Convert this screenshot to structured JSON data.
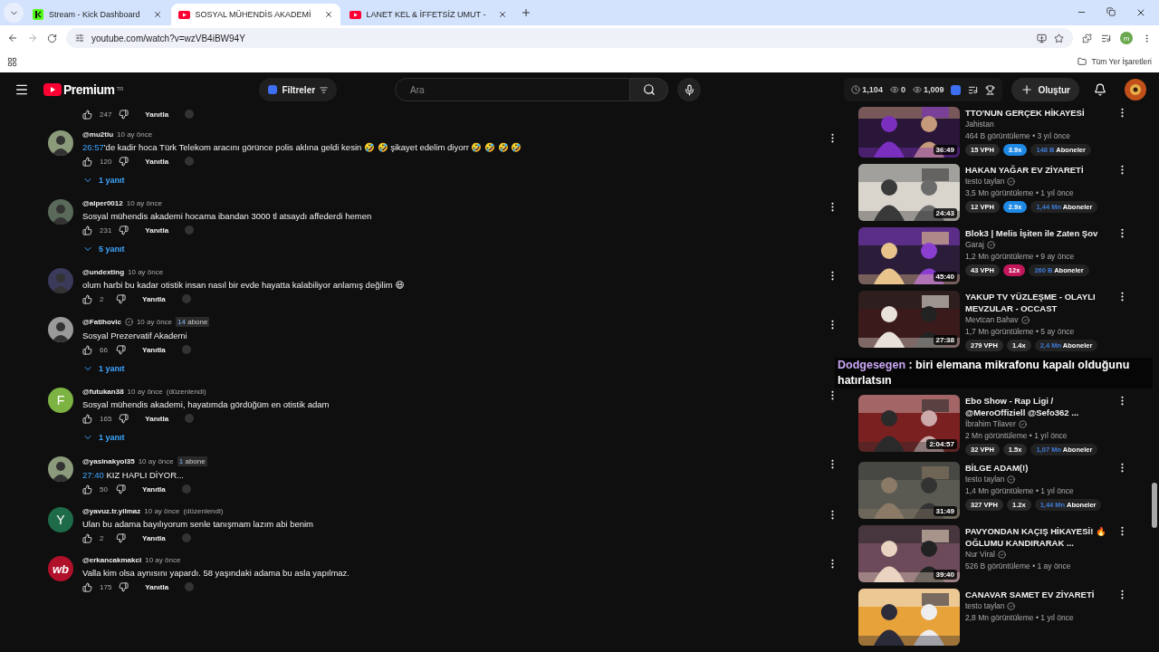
{
  "browser": {
    "tabs": [
      {
        "kind": "kick",
        "title": "Stream - Kick Dashboard",
        "selected": false
      },
      {
        "kind": "video",
        "title": "SOSYAL MÜHENDİS AKADEMİ",
        "selected": true
      },
      {
        "kind": "video",
        "title": "LANET KEL & İFFETSİZ UMUT -",
        "selected": false
      }
    ],
    "url": "youtube.com/watch?v=wzVB4iBW94Y",
    "profile": "m",
    "bookmarks_label": "Tüm Yer İşaretleri"
  },
  "header": {
    "logo": "Premium",
    "region": "TR",
    "filter_button": "Filtreler",
    "search": {
      "placeholder": "Ara"
    },
    "stats": [
      {
        "kind": "clock",
        "value": "1,104"
      },
      {
        "kind": "eye",
        "value": "0"
      },
      {
        "kind": "eye",
        "value": "1,009"
      }
    ],
    "create_button": "Oluştur"
  },
  "top_actions": {
    "likes": "247",
    "reply": "Yanıtla"
  },
  "comments": [
    {
      "user": "@mu2tlu",
      "time": "10 ay önce",
      "link": "26:57",
      "text": "'de kadir hoca Türk Telekom aracını görünce polis aklına geldi kesin 🤣 🤣 şikayet edelim diyorr 🤣 🤣 🤣 🤣",
      "likes": "120",
      "reply": "Yanıtla",
      "replies": "1 yanıt"
    },
    {
      "user": "@alper0012",
      "time": "10 ay önce",
      "text": "Sosyal mühendis akademi hocama ibandan 3000 tl atsaydı affederdi hemen",
      "likes": "231",
      "reply": "Yanıtla",
      "replies": "5 yanıt"
    },
    {
      "user": "@undexting",
      "time": "10 ay önce",
      "text": "olum harbi bu kadar otistik insan nasıl bir evde hayatta kalabiliyor anlamış değilim 😆",
      "likes": "2",
      "reply": "Yanıtla"
    },
    {
      "user": "@Fatihovic",
      "verified": true,
      "time": "10 ay önce",
      "badge": {
        "count": "14",
        "label": "abone"
      },
      "text": "Sosyal Prezervatif Akademi",
      "likes": "66",
      "reply": "Yanıtla",
      "replies": "1 yanıt"
    },
    {
      "user": "@futukan38",
      "time": "10 ay önce",
      "edited": "(düzenlendi)",
      "avatar": {
        "kind": "letter",
        "letter": "F",
        "color": "#7cb342"
      },
      "text": "Sosyal mühendis akademi, hayatımda gördüğüm en otistik adam",
      "likes": "165",
      "reply": "Yanıtla",
      "replies": "1 yanıt"
    },
    {
      "user": "@yasinakyol35",
      "time": "10 ay önce",
      "badge": {
        "count": "1",
        "label": "abone"
      },
      "link": "27:40",
      "text": " KIZ HAPLI DİYOR...",
      "likes": "50",
      "reply": "Yanıtla"
    },
    {
      "user": "@yavuz.tr.yilmaz",
      "time": "10 ay önce",
      "edited": "(düzenlendi)",
      "avatar": {
        "kind": "letter",
        "letter": "Y",
        "color": "#1e6b4a"
      },
      "text": "Ulan bu adama bayılıyorum senle tanışmam lazım abi benim",
      "likes": "2",
      "reply": "Yanıtla"
    },
    {
      "user": "@erkancakmakci",
      "time": "10 ay önce",
      "avatar": {
        "kind": "letter",
        "letter": "wb",
        "color": "#b0102a"
      },
      "text": "Valla kim olsa aynısını yapardı. 58 yaşındaki adama bu asla yapılmaz.",
      "likes": "175",
      "reply": "Yanıtla"
    }
  ],
  "videos": [
    {
      "title": "TTO'NUN GERÇEK HİKAYESİ",
      "channel": "Jahistan",
      "verified": false,
      "meta": "464 B görüntüleme • 3 yıl önce",
      "duration": "36:49",
      "stats": {
        "vph": "15 VPH",
        "ratio": "3.9x",
        "color": "#1e88e5",
        "subs": "148 B",
        "subs_label": "Aboneler"
      }
    },
    {
      "title": "HAKAN YAĞAR EV ZİYARETİ",
      "channel": "testo taylan",
      "verified": true,
      "meta": "3,5 Mn görüntüleme • 1 yıl önce",
      "duration": "24:43",
      "stats": {
        "vph": "12 VPH",
        "ratio": "2.9x",
        "color": "#1e88e5",
        "subs": "1,44 Mn",
        "subs_label": "Aboneler"
      }
    },
    {
      "title": "Blok3 | Melis İşiten ile Zaten Şov",
      "channel": "Garaj",
      "verified": true,
      "meta": "1,2 Mn görüntüleme • 9 ay önce",
      "duration": "45:40",
      "stats": {
        "vph": "43 VPH",
        "ratio": "12x",
        "color": "#c2185b",
        "subs": "260 B",
        "subs_label": "Aboneler"
      }
    },
    {
      "title": "YAKUP TV YÜZLEŞME - OLAYLI MEVZULAR - OCCAST",
      "channel": "Mevtcan Bahav",
      "verified": true,
      "meta": "1,7 Mn görüntüleme • 5 ay önce",
      "duration": "27:38",
      "stats": {
        "vph": "279 VPH",
        "ratio": "1.4x",
        "color": "#2a2a2a",
        "subs": "2,4 Mn",
        "subs_label": "Aboneler"
      }
    },
    {
      "title": "Ebo Show - Rap Ligi / @MeroOffiziell @Sefo362 ...",
      "channel": "İbrahim Tilaver",
      "verified": true,
      "meta": "2 Mn görüntüleme • 1 yıl önce",
      "duration": "2:04:57",
      "stats": {
        "vph": "32 VPH",
        "ratio": "1.5x",
        "color": "#2a2a2a",
        "subs": "1,07 Mn",
        "subs_label": "Aboneler"
      }
    },
    {
      "title": "BİLGE ADAM(!)",
      "channel": "testo taylan",
      "verified": true,
      "meta": "1,4 Mn görüntüleme • 1 yıl önce",
      "duration": "31:49",
      "stats": {
        "vph": "327 VPH",
        "ratio": "1.2x",
        "color": "#2a2a2a",
        "subs": "1,44 Mn",
        "subs_label": "Aboneler"
      }
    },
    {
      "title": "PAVYONDAN KAÇIŞ HİKAYESİ! 🔥 OĞLUMU KANDIRARAK ...",
      "channel": "Nur Viral",
      "verified": true,
      "meta": "526 B görüntüleme • 1 ay önce",
      "duration": "39:40"
    },
    {
      "title": "CANAVAR SAMET EV ZİYARETİ",
      "channel": "testo taylan",
      "verified": true,
      "meta": "2,8 Mn görüntüleme • 1 yıl önce"
    }
  ],
  "chat_overlay": {
    "user": "Dodgesegen",
    "message": " : biri elemana mikrafonu kapalı olduğunu hatırlatsın"
  }
}
